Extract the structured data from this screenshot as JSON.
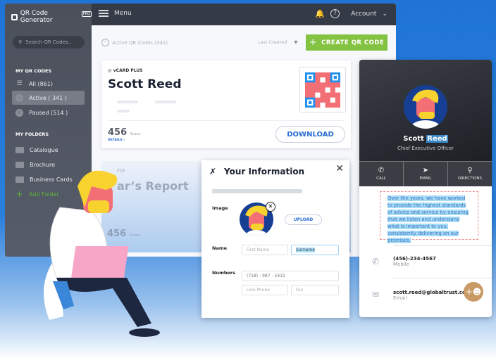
{
  "app": {
    "brand": "QR Code Generator",
    "brand_badge": "PRO",
    "menu": "Menu",
    "account": "Account"
  },
  "sidebar": {
    "search_placeholder": "Search QR Codes...",
    "my_qr_codes": "MY QR CODES",
    "items": [
      {
        "label": "All (861)",
        "icon": "list-icon"
      },
      {
        "label": "Active ( 341 )",
        "icon": "pulse-icon",
        "active": true
      },
      {
        "label": "Paused (514 )",
        "icon": "pause-icon"
      }
    ],
    "my_folders": "MY FOLDERS",
    "folders": [
      "Catalogue",
      "Brochure",
      "Business Cards"
    ],
    "add_folder": "Add Folder"
  },
  "main": {
    "subtitle": "Active QR Codes (341)",
    "sort": "Last Created",
    "create": "CREATE QR CODE",
    "cards": [
      {
        "type": "vCARD PLUS",
        "name": "Scott Reed",
        "scans": "456",
        "scans_label": "Scans",
        "details": "DETAILS",
        "download": "DOWNLOAD"
      },
      {
        "type": "PDF",
        "name": "ar’s Report",
        "scans": "456",
        "scans_label": "Scans"
      }
    ]
  },
  "dialog": {
    "title": "Your Information",
    "image_label": "Image",
    "upload": "UPLOAD",
    "name_label": "Name",
    "first_name": "First Name",
    "surname": "Surname",
    "numbers_label": "Numbers",
    "phone": "(718) - 987 - 5432",
    "line_phone": "Line Phone",
    "fax": "Fax"
  },
  "phone": {
    "first": "Scott",
    "last": "Reed",
    "title": "Chief Executive Officer",
    "actions": [
      "CALL",
      "EMAIL",
      "DIRECTIONS"
    ],
    "about": "Over the years, we have worked to provide the highest standards of advice and service by ensuring that we listen and understand what is important to you, consistently delivering on our promises.",
    "mobile": "(456)-234-4567",
    "mobile_label": "Mobile",
    "email": "scott.reed@globaltrust.co",
    "email_label": "Email"
  },
  "colors": {
    "accent_green": "#84c241",
    "link_blue": "#2b6dd0",
    "background_blue": "#1f74d6"
  }
}
